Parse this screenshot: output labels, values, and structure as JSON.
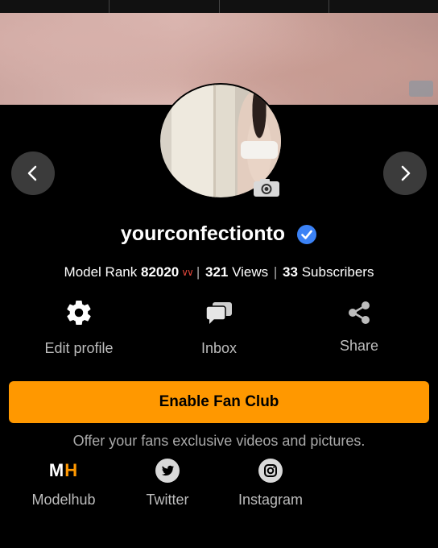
{
  "profile": {
    "username": "yourconfectionto",
    "model_rank_label": "Model Rank",
    "model_rank": "82020",
    "views_count": "321",
    "views_label": "Views",
    "subscribers_count": "33",
    "subscribers_label": "Subscribers",
    "separator": "|"
  },
  "actions": {
    "edit_profile": "Edit profile",
    "inbox": "Inbox",
    "share": "Share"
  },
  "fan_club": {
    "button_label": "Enable Fan Club",
    "description": "Offer your fans exclusive videos and pictures."
  },
  "social": {
    "modelhub_logo_m": "M",
    "modelhub_logo_h": "H",
    "modelhub_label": "Modelhub",
    "twitter_label": "Twitter",
    "instagram_label": "Instagram"
  },
  "icons": {
    "prev": "chevron-left-icon",
    "next": "chevron-right-icon",
    "camera": "camera-icon",
    "verified": "verified-check-icon",
    "edit": "gear-icon",
    "inbox": "chat-bubbles-icon",
    "share": "share-icon",
    "twitter": "twitter-bird-icon",
    "instagram": "instagram-icon"
  },
  "colors": {
    "accent": "#ff9800",
    "verified": "#3b82f6",
    "rank_down": "#e0453a",
    "background": "#000000",
    "muted_text": "#bdbdbd"
  }
}
